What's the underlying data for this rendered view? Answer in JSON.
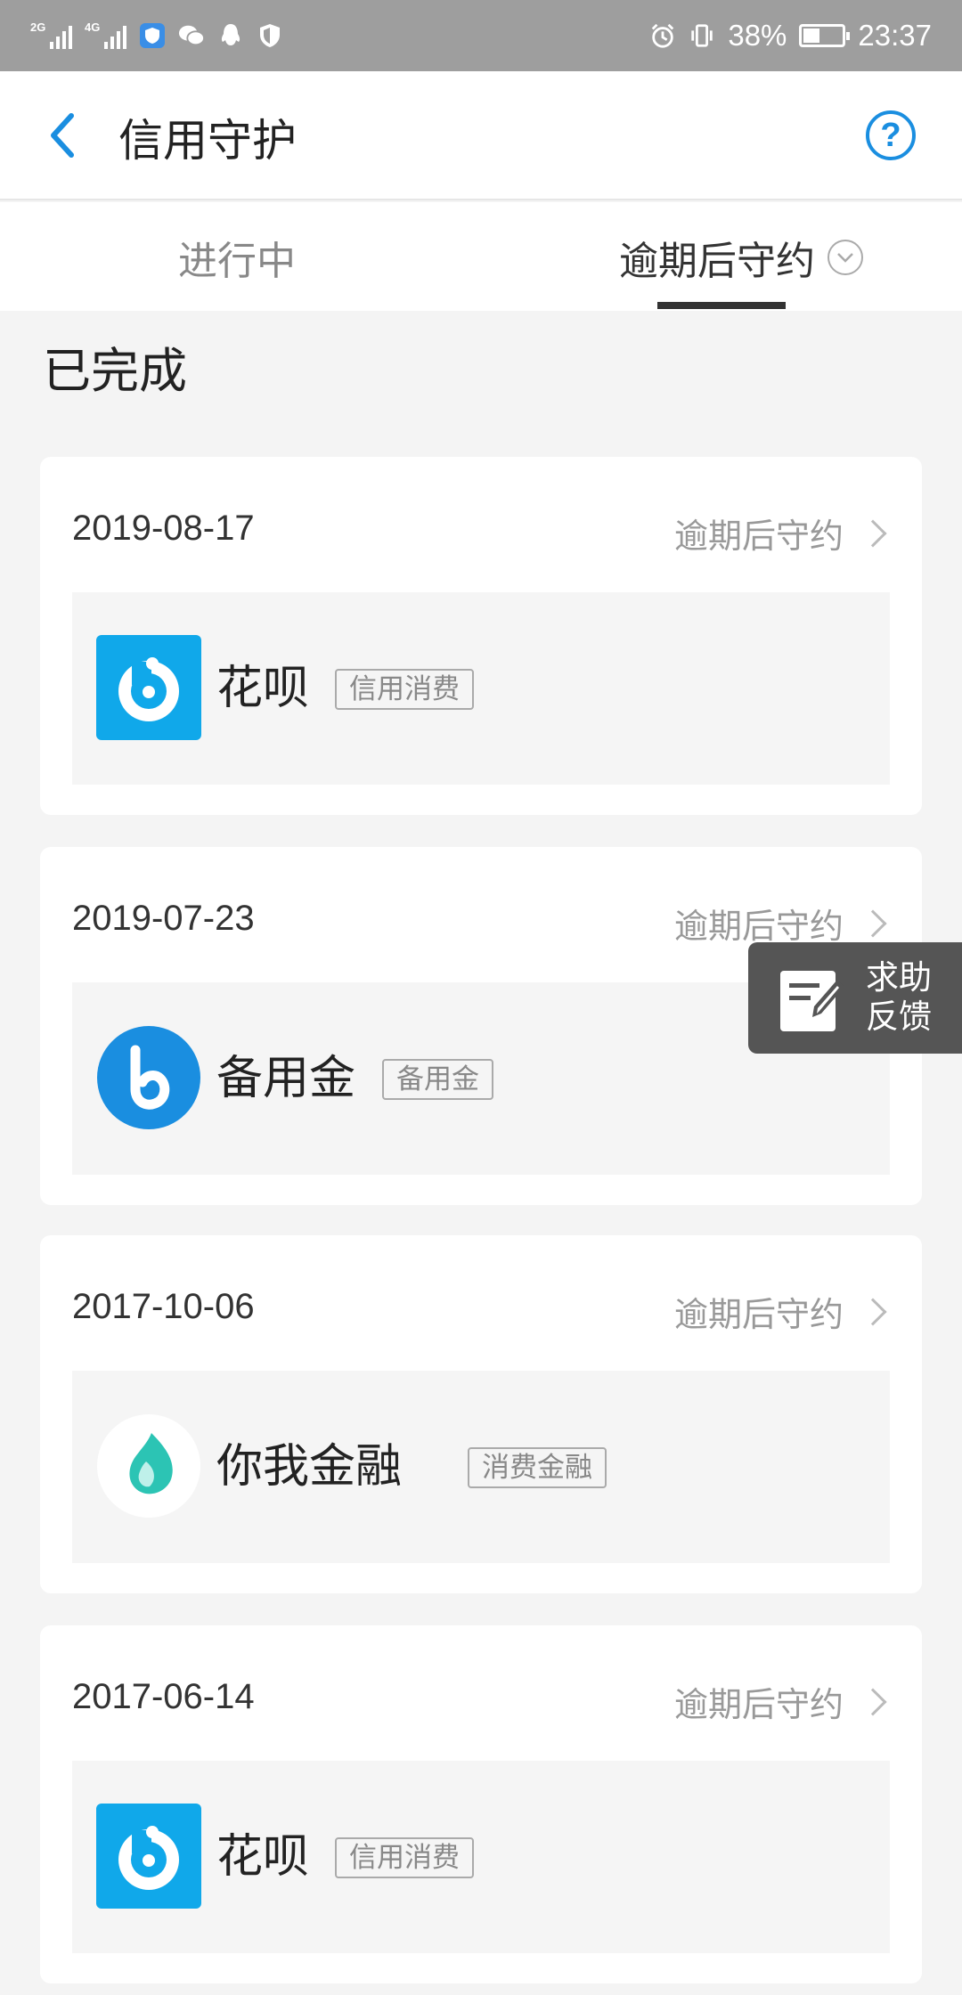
{
  "status_bar": {
    "net1": "2G",
    "net2": "4G",
    "battery": "38%",
    "battery_level": 0.38,
    "time": "23:37"
  },
  "header": {
    "title": "信用守护",
    "help": "?"
  },
  "tabs": [
    {
      "label": "进行中",
      "active": false
    },
    {
      "label": "逾期后守约",
      "active": true
    }
  ],
  "section_title": "已完成",
  "records": [
    {
      "date": "2019-08-17",
      "status": "逾期后守约",
      "app": "花呗",
      "tag": "信用消费",
      "icon": "huabei-logo"
    },
    {
      "date": "2019-07-23",
      "status": "逾期后守约",
      "app": "备用金",
      "tag": "备用金",
      "icon": "beiyongjin-logo"
    },
    {
      "date": "2017-10-06",
      "status": "逾期后守约",
      "app": "你我金融",
      "tag": "消费金融",
      "icon": "niwojinrong-logo"
    },
    {
      "date": "2017-06-14",
      "status": "逾期后守约",
      "app": "花呗",
      "tag": "信用消费",
      "icon": "huabei-logo"
    }
  ],
  "float_help": {
    "line1": "求助",
    "line2": "反馈"
  },
  "colors": {
    "accent": "#1a8ee0",
    "huabei": "#10a8ea",
    "niwo": "#2cc4b4"
  }
}
